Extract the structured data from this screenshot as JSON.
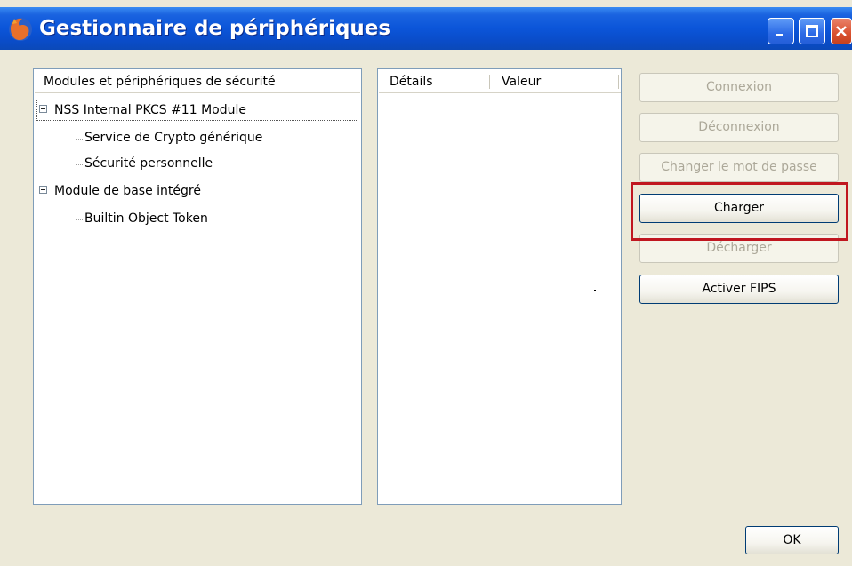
{
  "window": {
    "title": "Gestionnaire de périphériques",
    "icon": "firefox-icon",
    "controls": [
      "minimize-icon",
      "maximize-icon",
      "close-icon"
    ]
  },
  "tree": {
    "header": "Modules et périphériques de sécurité",
    "items": [
      {
        "label": "NSS Internal PKCS #11 Module",
        "expanded": true,
        "children": [
          "Service de Crypto générique",
          "Sécurité personnelle"
        ]
      },
      {
        "label": "Module de base intégré",
        "expanded": true,
        "children": [
          "Builtin Object Token"
        ]
      }
    ]
  },
  "details": {
    "columns": [
      "Détails",
      "Valeur"
    ]
  },
  "buttons": {
    "connexion": "Connexion",
    "deconnexion": "Déconnexion",
    "changer_mot_de_passe": "Changer le mot de passe",
    "charger": "Charger",
    "decharger": "Décharger",
    "activer_fips": "Activer FIPS",
    "ok": "OK"
  },
  "colors": {
    "titlebar": "#0b55d9",
    "highlight": "#c0161f",
    "disabled_text": "#aca899"
  }
}
